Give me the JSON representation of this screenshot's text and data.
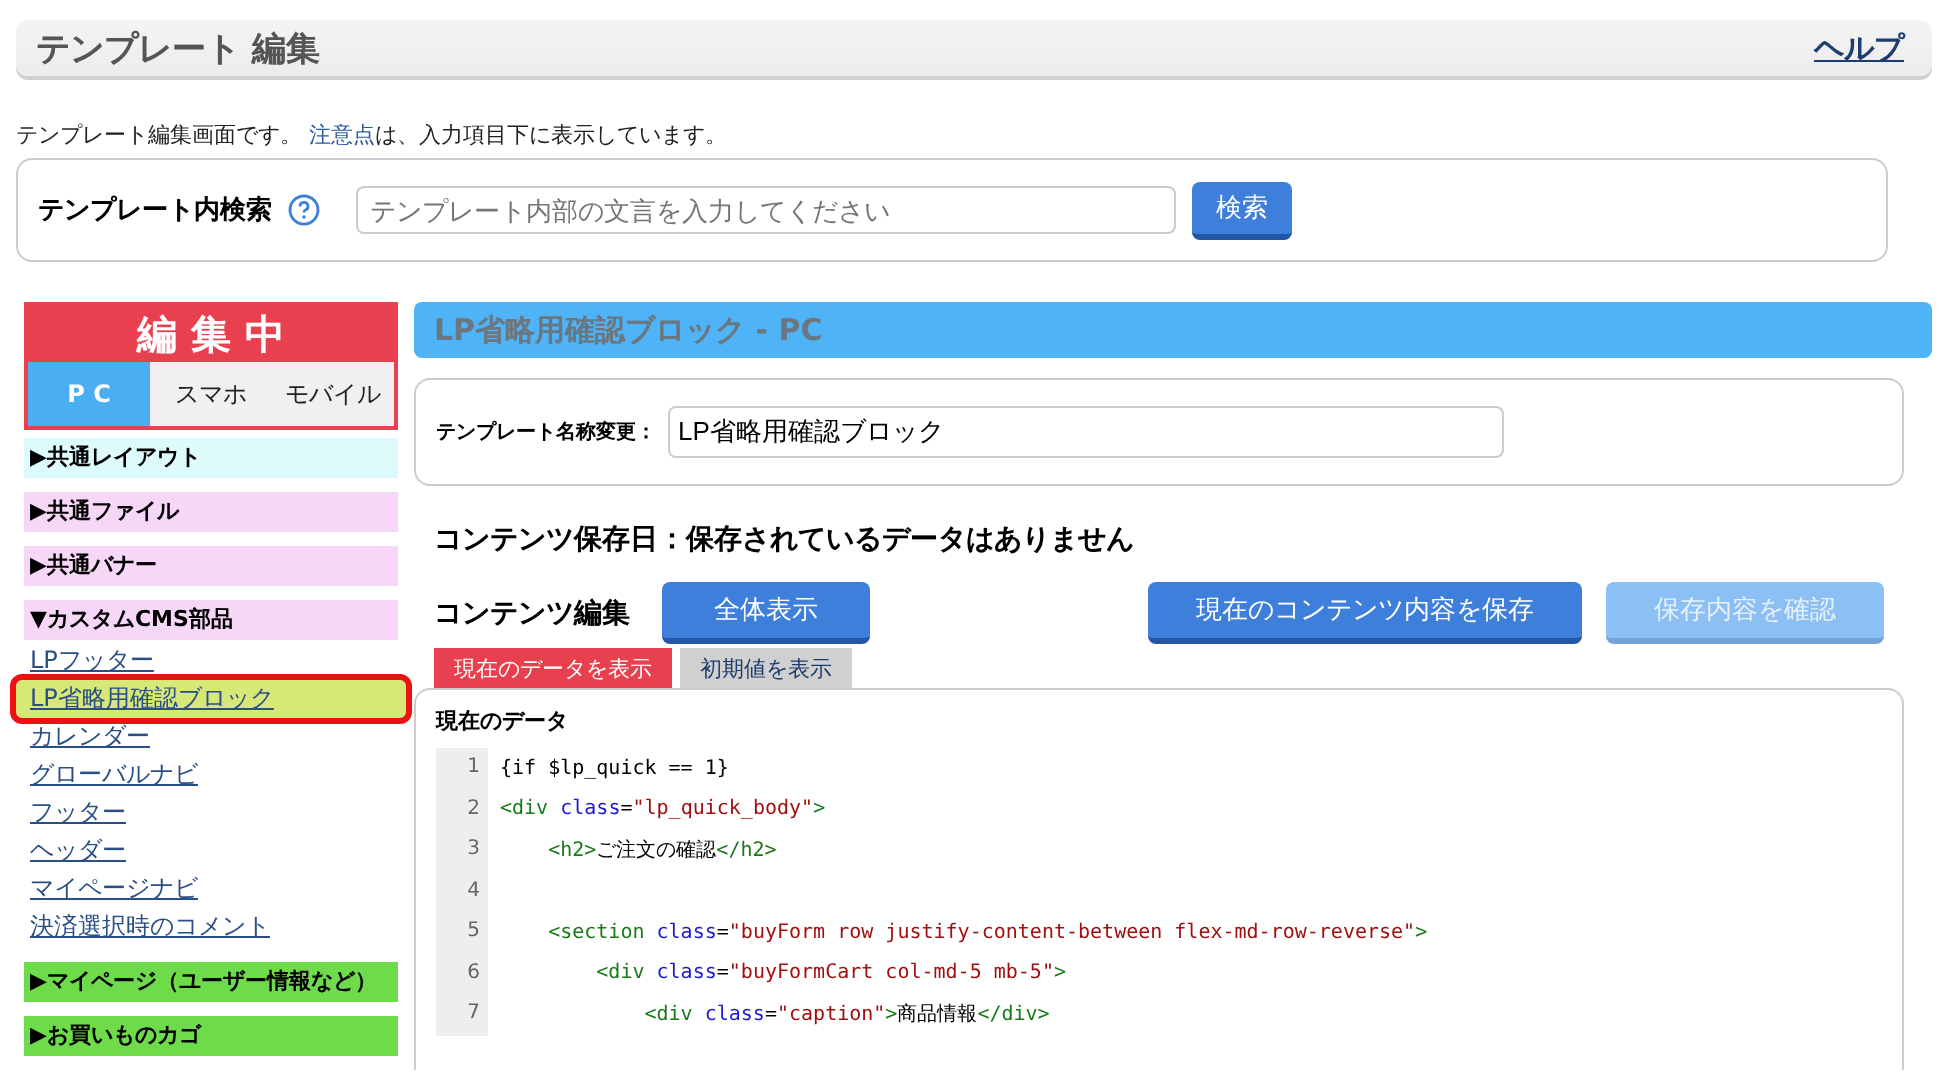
{
  "header": {
    "title": "テンプレート 編集",
    "help": "ヘルプ"
  },
  "intro": {
    "before": "テンプレート編集画面です。",
    "link": "注意点",
    "after": "は、入力項目下に表示しています。"
  },
  "search": {
    "label": "テンプレート内検索",
    "placeholder": "テンプレート内部の文言を入力してください",
    "button": "検索"
  },
  "editing": {
    "title": "編 集 中",
    "tabs": [
      {
        "label": "P C",
        "selected": true
      },
      {
        "label": "スマホ",
        "selected": false
      },
      {
        "label": "モバイル",
        "selected": false
      }
    ]
  },
  "sidebar": [
    {
      "label": "▶共通レイアウト",
      "color": "#ddfbfd"
    },
    {
      "label": "▶共通ファイル",
      "color": "#f7d7f7"
    },
    {
      "label": "▶共通バナー",
      "color": "#f7d7f7"
    },
    {
      "label": "▼カスタムCMS部品",
      "color": "#f7d7f7",
      "children": [
        {
          "label": "LPフッター",
          "selected": false
        },
        {
          "label": "LP省略用確認ブロック",
          "selected": true
        },
        {
          "label": "カレンダー",
          "selected": false
        },
        {
          "label": "グローバルナビ",
          "selected": false
        },
        {
          "label": "フッター",
          "selected": false
        },
        {
          "label": "ヘッダー",
          "selected": false
        },
        {
          "label": "マイページナビ",
          "selected": false
        },
        {
          "label": "決済選択時のコメント",
          "selected": false
        }
      ]
    },
    {
      "label": "▶マイページ（ユーザー情報など）",
      "color": "#6edb4a"
    },
    {
      "label": "▶お買いものカゴ",
      "color": "#6edb4a"
    }
  ],
  "main": {
    "title": "LP省略用確認ブロック - PC",
    "rename_label": "テンプレート名称変更：",
    "rename_value": "LP省略用確認ブロック",
    "saved_date": "コンテンツ保存日：保存されているデータはありません",
    "edit_label": "コンテンツ編集",
    "show_all": "全体表示",
    "save_button": "現在のコンテンツ内容を保存",
    "confirm_button": {
      "label": "保存内容を確認",
      "disabled": true
    },
    "view_tabs": [
      {
        "label": "現在のデータを表示",
        "selected": true
      },
      {
        "label": "初期値を表示",
        "selected": false
      }
    ],
    "data_title": "現在のデータ",
    "code": [
      {
        "number": "1",
        "tokens": [
          {
            "kind": "text",
            "text": "{if $lp_quick == 1}"
          }
        ]
      },
      {
        "number": "2",
        "tokens": [
          {
            "kind": "tag",
            "text": "<div"
          },
          {
            "kind": "attr",
            "text": " class"
          },
          {
            "kind": "text",
            "text": "="
          },
          {
            "kind": "string",
            "text": "\"lp_quick_body\""
          },
          {
            "kind": "tag",
            "text": ">"
          }
        ]
      },
      {
        "number": "3",
        "tokens": [
          {
            "kind": "tag",
            "text": "    <h2>"
          },
          {
            "kind": "text",
            "text": "ご注文の確認"
          },
          {
            "kind": "tag",
            "text": "</h2>"
          }
        ]
      },
      {
        "number": "4"
      },
      {
        "number": "5",
        "tokens": [
          {
            "kind": "tag",
            "text": "    <section"
          },
          {
            "kind": "attr",
            "text": " class"
          },
          {
            "kind": "text",
            "text": "="
          },
          {
            "kind": "string",
            "text": "\"buyForm row justify-content-between flex-md-row-reverse\""
          },
          {
            "kind": "tag",
            "text": ">"
          }
        ]
      },
      {
        "number": "6",
        "tokens": [
          {
            "kind": "tag",
            "text": "        <div"
          },
          {
            "kind": "attr",
            "text": " class"
          },
          {
            "kind": "text",
            "text": "="
          },
          {
            "kind": "string",
            "text": "\"buyFormCart col-md-5 mb-5\""
          },
          {
            "kind": "tag",
            "text": ">"
          }
        ]
      },
      {
        "number": "7",
        "tokens": [
          {
            "kind": "tag",
            "text": "            <div"
          },
          {
            "kind": "attr",
            "text": " class"
          },
          {
            "kind": "text",
            "text": "="
          },
          {
            "kind": "string",
            "text": "\"caption\""
          },
          {
            "kind": "tag",
            "text": ">"
          },
          {
            "kind": "text",
            "text": "商品情報"
          },
          {
            "kind": "tag",
            "text": "</div>"
          }
        ]
      }
    ]
  }
}
